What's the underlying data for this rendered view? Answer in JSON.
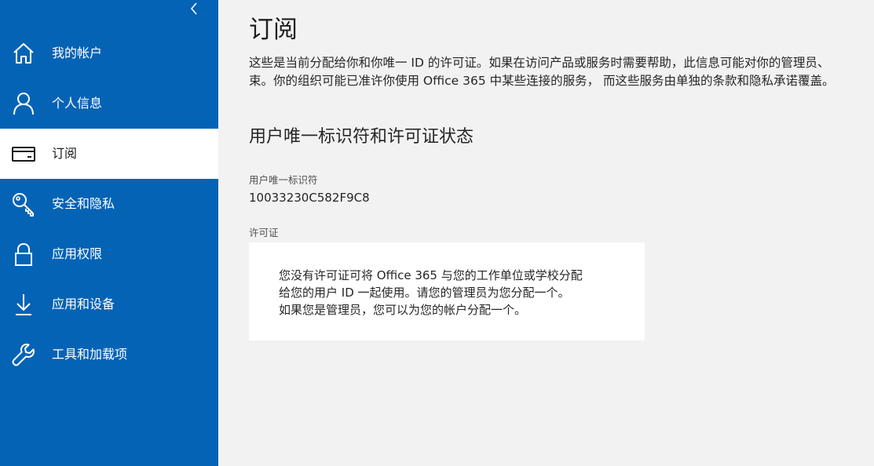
{
  "sidebar": {
    "collapse_icon": "chevron-left-icon",
    "items": [
      {
        "id": "my-account",
        "label": "我的帐户",
        "icon": "home-icon",
        "active": false
      },
      {
        "id": "personal-info",
        "label": "个人信息",
        "icon": "person-icon",
        "active": false
      },
      {
        "id": "subscriptions",
        "label": "订阅",
        "icon": "card-icon",
        "active": true
      },
      {
        "id": "security-privacy",
        "label": "安全和隐私",
        "icon": "key-icon",
        "active": false
      },
      {
        "id": "app-permissions",
        "label": "应用权限",
        "icon": "lock-icon",
        "active": false
      },
      {
        "id": "apps-devices",
        "label": "应用和设备",
        "icon": "download-icon",
        "active": false
      },
      {
        "id": "tools-addins",
        "label": "工具和加载项",
        "icon": "wrench-icon",
        "active": false
      }
    ]
  },
  "main": {
    "title": "订阅",
    "intro_line1": "这些是当前分配给你和你唯一 ID 的许可证。如果在访问产品或服务时需要帮助，此信息可能对你的管理员、",
    "intro_line2": "束。你的组织可能已准许你使用 Office 365 中某些连接的服务， 而这些服务由单独的条款和隐私承诺覆盖。",
    "section_title": "用户唯一标识符和许可证状态",
    "uid_label": "用户唯一标识符",
    "uid_value": "10033230C582F9C8",
    "license_label": "许可证",
    "license_message_line1": "您没有许可证可将 Office 365 与您的工作单位或学校分配",
    "license_message_line2": "给您的用户 ID 一起使用。请您的管理员为您分配一个。",
    "license_message_line3": "如果您是管理员，您可以为您的帐户分配一个。"
  },
  "colors": {
    "sidebar_bg": "#0563b5",
    "page_bg": "#f2f2f2",
    "card_bg": "#ffffff",
    "active_item_bg": "#ffffff"
  }
}
